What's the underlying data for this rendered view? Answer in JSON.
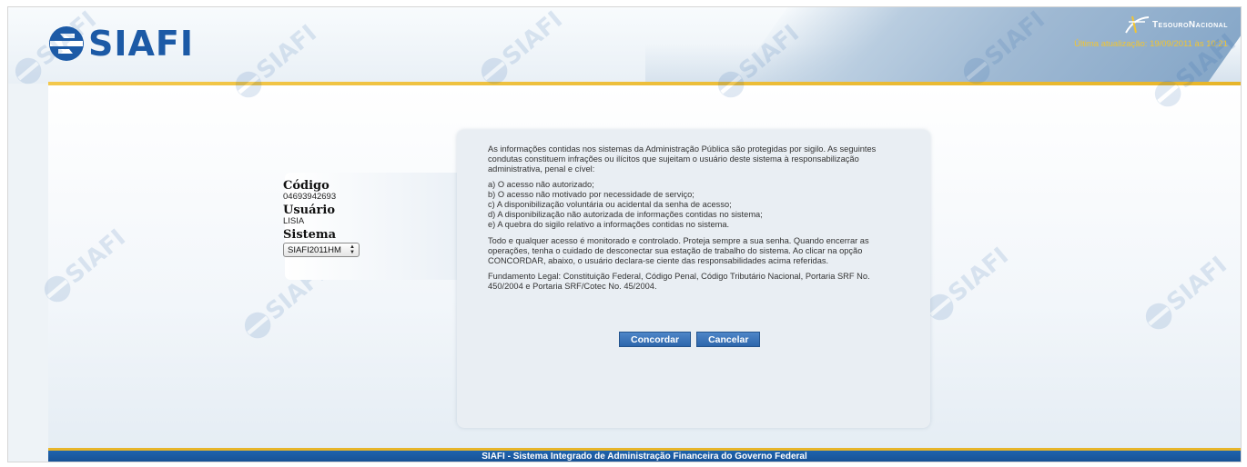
{
  "header": {
    "logo_text": "SIAFI",
    "org_name": "TesouroNacional",
    "last_update": "Última atualização: 19/09/2011 às 10:21"
  },
  "watermark_text": "SIAFI",
  "login": {
    "codigo_label": "Código",
    "codigo_value": "04693942693",
    "usuario_label": "Usuário",
    "usuario_value": "LISIA",
    "sistema_label": "Sistema",
    "sistema_selected": "SIAFI2011HM"
  },
  "notice": {
    "intro": "As informações contidas nos sistemas da Administração Pública são protegidas por sigilo. As seguintes condutas constituem infrações ou ilícitos que sujeitam o usuário deste sistema à responsabilização administrativa, penal e cível:",
    "items": [
      "a) O acesso não autorizado;",
      "b) O acesso não motivado por necessidade de serviço;",
      "c) A disponibilização voluntária ou acidental da senha de acesso;",
      "d) A disponibilização não autorizada de informações contidas no sistema;",
      "e) A quebra do sigilo relativo a informações contidas no sistema."
    ],
    "monitor": "Todo e qualquer acesso é monitorado e controlado. Proteja sempre a sua senha. Quando encerrar as operações, tenha o cuidado de desconectar sua estação de trabalho do sistema. Ao clicar na opção CONCORDAR, abaixo, o usuário declara-se ciente das responsabilidades acima referidas.",
    "legal": "Fundamento Legal: Constituição Federal, Código Penal, Código Tributário Nacional, Portaria SRF No. 450/2004 e Portaria SRF/Cotec No. 45/2004."
  },
  "buttons": {
    "agree": "Concordar",
    "cancel": "Cancelar"
  },
  "footer": {
    "text": "SIAFI - Sistema Integrado de Administração Financeira do Governo Federal"
  },
  "colors": {
    "brand_blue": "#1c5aa6",
    "accent_gold": "#e7b52a",
    "button_blue": "#2d66ab"
  }
}
